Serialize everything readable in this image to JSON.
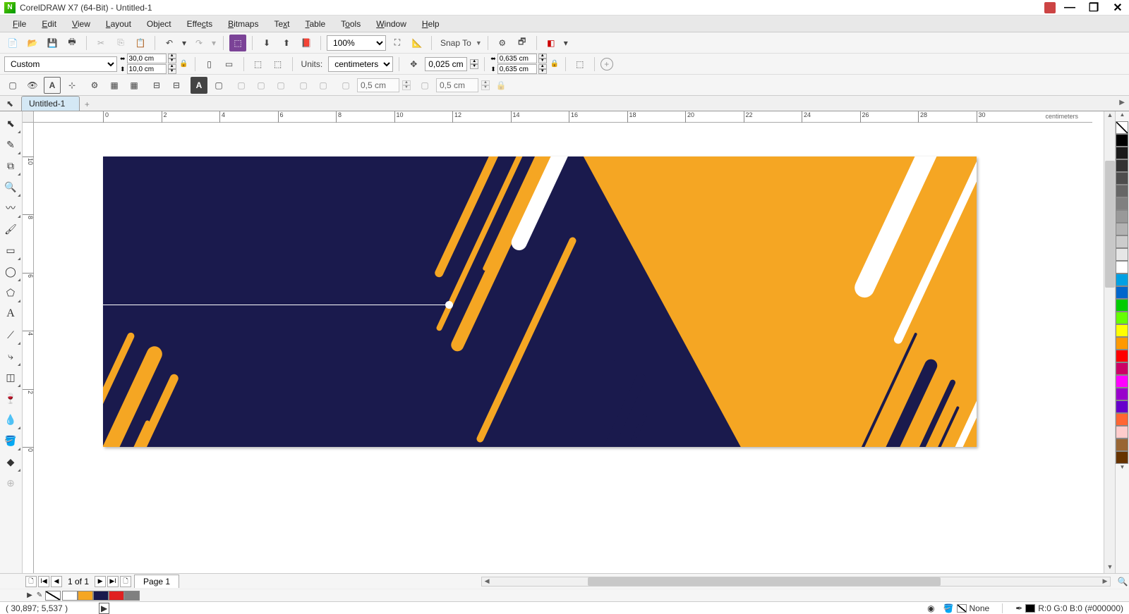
{
  "title": "CorelDRAW X7 (64-Bit) - Untitled-1",
  "menu": [
    "File",
    "Edit",
    "View",
    "Layout",
    "Object",
    "Effects",
    "Bitmaps",
    "Text",
    "Table",
    "Tools",
    "Window",
    "Help"
  ],
  "toolbar1": {
    "zoom": "100%",
    "snap_label": "Snap To"
  },
  "property_bar": {
    "preset": "Custom",
    "page_width": "30,0 cm",
    "page_height": "10,0 cm",
    "units_label": "Units:",
    "units_value": "centimeters",
    "nudge": "0,025 cm",
    "dup_x": "0,635 cm",
    "dup_y": "0,635 cm"
  },
  "toolbar3": {
    "val1": "0,5 cm",
    "val2": "0,5 cm"
  },
  "doc_tab": "Untitled-1",
  "ruler_unit": "centimeters",
  "ruler_h_ticks": [
    "0",
    "2",
    "4",
    "6",
    "8",
    "10",
    "12",
    "14",
    "16",
    "18",
    "20",
    "22",
    "24",
    "26",
    "28",
    "30"
  ],
  "ruler_v_ticks": [
    "0",
    "2",
    "4",
    "6",
    "8",
    "10"
  ],
  "page_nav": {
    "counter": "1 of 1",
    "page_tab": "Page 1"
  },
  "doc_palette": [
    "#ffffff",
    "#f5a623",
    "#1a1a4d",
    "#e02020",
    "#808080"
  ],
  "color_palette": [
    "none",
    "#000000",
    "#1a1a1a",
    "#333333",
    "#4d4d4d",
    "#666666",
    "#808080",
    "#999999",
    "#b3b3b3",
    "#cccccc",
    "#e6e6e6",
    "#ffffff",
    "#00a0e3",
    "#0066cc",
    "#00cc00",
    "#66ff00",
    "#ffff00",
    "#ff9900",
    "#ff0000",
    "#cc0066",
    "#ff00ff",
    "#9900cc",
    "#6600cc",
    "#ff6633",
    "#ffcccc",
    "#996633",
    "#663300"
  ],
  "status": {
    "coords": "( 30,897; 5,537 )",
    "fill_none_label": "None",
    "outline_info": "R:0 G:0 B:0 (#000000)"
  },
  "canvas_colors": {
    "navy": "#1a1a4d",
    "orange": "#f5a623",
    "white": "#ffffff"
  }
}
